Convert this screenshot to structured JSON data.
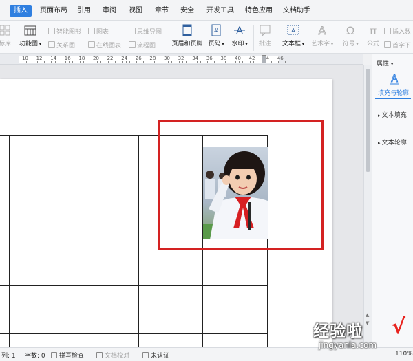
{
  "menu": {
    "items": [
      "插入",
      "页面布局",
      "引用",
      "审阅",
      "视图",
      "章节",
      "安全",
      "开发工具",
      "特色应用",
      "文档助手"
    ],
    "active": "插入"
  },
  "toolbar": {
    "left_label_1": "标库",
    "func_chart": "功能图",
    "smart_shape": "智能图形",
    "chart": "图表",
    "mind_map": "思维导图",
    "relation_map": "关系图",
    "online_chart": "在线图表",
    "flow_chart": "流程图",
    "header_footer": "页眉和页脚",
    "page_number": "页码",
    "watermark": "水印",
    "comment": "批注",
    "text_box": "文本框",
    "word_art": "艺术字",
    "symbol": "符号",
    "formula": "公式",
    "insert_number": "插入数",
    "dropcap": "首字下"
  },
  "ruler": {
    "numbers": [
      "10",
      "12",
      "14",
      "16",
      "18",
      "20",
      "22",
      "24",
      "26",
      "28",
      "30",
      "32",
      "34",
      "36",
      "38",
      "40",
      "42",
      "44",
      "46"
    ]
  },
  "right_panel": {
    "title": "属性",
    "tab": "填充与轮廓",
    "text_fill": "文本填充",
    "text_outline": "文本轮廓"
  },
  "status": {
    "column": "列: 1",
    "word_count": "字数: 0",
    "spell_check": "拼写检查",
    "doc_proof": "文档校对",
    "unverified": "未认证",
    "zoom": "110%"
  },
  "watermark": {
    "text": "经验啦",
    "check": "√",
    "url": "jingyanla.com"
  },
  "colors": {
    "accent": "#2f7fe0",
    "highlight_box": "#d42222"
  }
}
